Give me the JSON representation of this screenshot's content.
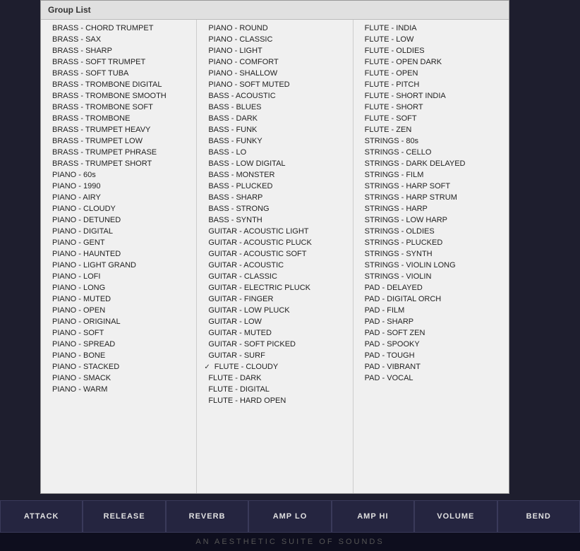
{
  "header": {
    "title": "Group List"
  },
  "footer": {
    "text": "AN AESTHETIC SUITE OF SOUNDS"
  },
  "controls": [
    {
      "id": "attack",
      "label": "ATTACK"
    },
    {
      "id": "release",
      "label": "RELEASE"
    },
    {
      "id": "reverb",
      "label": "REVERB"
    },
    {
      "id": "amp-lo",
      "label": "AMP LO"
    },
    {
      "id": "amp-hi",
      "label": "AMP HI"
    },
    {
      "id": "volume",
      "label": "VOLUME"
    },
    {
      "id": "bend",
      "label": "BEND"
    }
  ],
  "columns": [
    {
      "id": "col1",
      "items": [
        {
          "label": "BRASS - CHORD TRUMPET",
          "checked": false
        },
        {
          "label": "BRASS - SAX",
          "checked": false
        },
        {
          "label": "BRASS - SHARP",
          "checked": false
        },
        {
          "label": "BRASS - SOFT TRUMPET",
          "checked": false
        },
        {
          "label": "BRASS - SOFT TUBA",
          "checked": false
        },
        {
          "label": "BRASS - TROMBONE DIGITAL",
          "checked": false
        },
        {
          "label": "BRASS - TROMBONE SMOOTH",
          "checked": false
        },
        {
          "label": "BRASS - TROMBONE SOFT",
          "checked": false
        },
        {
          "label": "BRASS - TROMBONE",
          "checked": false
        },
        {
          "label": "BRASS - TRUMPET HEAVY",
          "checked": false
        },
        {
          "label": "BRASS - TRUMPET LOW",
          "checked": false
        },
        {
          "label": "BRASS - TRUMPET PHRASE",
          "checked": false
        },
        {
          "label": "BRASS - TRUMPET SHORT",
          "checked": false
        },
        {
          "label": "PIANO - 60s",
          "checked": false
        },
        {
          "label": "PIANO - 1990",
          "checked": false
        },
        {
          "label": "PIANO - AIRY",
          "checked": false
        },
        {
          "label": "PIANO - CLOUDY",
          "checked": false
        },
        {
          "label": "PIANO - DETUNED",
          "checked": false
        },
        {
          "label": "PIANO - DIGITAL",
          "checked": false
        },
        {
          "label": "PIANO - GENT",
          "checked": false
        },
        {
          "label": "PIANO - HAUNTED",
          "checked": false
        },
        {
          "label": "PIANO - LIGHT GRAND",
          "checked": false
        },
        {
          "label": "PIANO - LOFI",
          "checked": false
        },
        {
          "label": "PIANO - LONG",
          "checked": false
        },
        {
          "label": "PIANO - MUTED",
          "checked": false
        },
        {
          "label": "PIANO - OPEN",
          "checked": false
        },
        {
          "label": "PIANO - ORIGINAL",
          "checked": false
        },
        {
          "label": "PIANO - SOFT",
          "checked": false
        },
        {
          "label": "PIANO - SPREAD",
          "checked": false
        },
        {
          "label": "PIANO - BONE",
          "checked": false
        },
        {
          "label": "PIANO - STACKED",
          "checked": false
        },
        {
          "label": "PIANO - SMACK",
          "checked": false
        },
        {
          "label": "PIANO - WARM",
          "checked": false
        }
      ]
    },
    {
      "id": "col2",
      "items": [
        {
          "label": "PIANO - ROUND",
          "checked": false
        },
        {
          "label": "PIANO - CLASSIC",
          "checked": false
        },
        {
          "label": "PIANO - LIGHT",
          "checked": false
        },
        {
          "label": "PIANO - COMFORT",
          "checked": false
        },
        {
          "label": "PIANO - SHALLOW",
          "checked": false
        },
        {
          "label": "PIANO - SOFT MUTED",
          "checked": false
        },
        {
          "label": "BASS - ACOUSTIC",
          "checked": false
        },
        {
          "label": "BASS - BLUES",
          "checked": false
        },
        {
          "label": "BASS - DARK",
          "checked": false
        },
        {
          "label": "BASS - FUNK",
          "checked": false
        },
        {
          "label": "BASS - FUNKY",
          "checked": false
        },
        {
          "label": "BASS - LO",
          "checked": false
        },
        {
          "label": "BASS - LOW DIGITAL",
          "checked": false
        },
        {
          "label": "BASS - MONSTER",
          "checked": false
        },
        {
          "label": "BASS - PLUCKED",
          "checked": false
        },
        {
          "label": "BASS - SHARP",
          "checked": false
        },
        {
          "label": "BASS - STRONG",
          "checked": false
        },
        {
          "label": "BASS - SYNTH",
          "checked": false
        },
        {
          "label": "GUITAR - ACOUSTIC LIGHT",
          "checked": false
        },
        {
          "label": "GUITAR - ACOUSTIC PLUCK",
          "checked": false
        },
        {
          "label": "GUITAR - ACOUSTIC SOFT",
          "checked": false
        },
        {
          "label": "GUITAR - ACOUSTIC",
          "checked": false
        },
        {
          "label": "GUITAR - CLASSIC",
          "checked": false
        },
        {
          "label": "GUITAR - ELECTRIC PLUCK",
          "checked": false
        },
        {
          "label": "GUITAR - FINGER",
          "checked": false
        },
        {
          "label": "GUITAR - LOW PLUCK",
          "checked": false
        },
        {
          "label": "GUITAR - LOW",
          "checked": false
        },
        {
          "label": "GUITAR - MUTED",
          "checked": false
        },
        {
          "label": "GUITAR - SOFT PICKED",
          "checked": false
        },
        {
          "label": "GUITAR - SURF",
          "checked": false
        },
        {
          "label": "FLUTE - CLOUDY",
          "checked": true
        },
        {
          "label": "FLUTE - DARK",
          "checked": false
        },
        {
          "label": "FLUTE - DIGITAL",
          "checked": false
        },
        {
          "label": "FLUTE - HARD OPEN",
          "checked": false
        }
      ]
    },
    {
      "id": "col3",
      "items": [
        {
          "label": "FLUTE - INDIA",
          "checked": false
        },
        {
          "label": "FLUTE - LOW",
          "checked": false
        },
        {
          "label": "FLUTE - OLDIES",
          "checked": false
        },
        {
          "label": "FLUTE - OPEN DARK",
          "checked": false
        },
        {
          "label": "FLUTE - OPEN",
          "checked": false
        },
        {
          "label": "FLUTE - PITCH",
          "checked": false
        },
        {
          "label": "FLUTE - SHORT INDIA",
          "checked": false
        },
        {
          "label": "FLUTE - SHORT",
          "checked": false
        },
        {
          "label": "FLUTE - SOFT",
          "checked": false
        },
        {
          "label": "FLUTE - ZEN",
          "checked": false
        },
        {
          "label": "STRINGS - 80s",
          "checked": false
        },
        {
          "label": "STRINGS - CELLO",
          "checked": false
        },
        {
          "label": "STRINGS - DARK DELAYED",
          "checked": false
        },
        {
          "label": "STRINGS - FILM",
          "checked": false
        },
        {
          "label": "STRINGS - HARP SOFT",
          "checked": false
        },
        {
          "label": "STRINGS - HARP STRUM",
          "checked": false
        },
        {
          "label": "STRINGS - HARP",
          "checked": false
        },
        {
          "label": "STRINGS - LOW HARP",
          "checked": false
        },
        {
          "label": "STRINGS - OLDIES",
          "checked": false
        },
        {
          "label": "STRINGS - PLUCKED",
          "checked": false
        },
        {
          "label": "STRINGS - SYNTH",
          "checked": false
        },
        {
          "label": "STRINGS - VIOLIN LONG",
          "checked": false
        },
        {
          "label": "STRINGS - VIOLIN",
          "checked": false
        },
        {
          "label": "PAD - DELAYED",
          "checked": false
        },
        {
          "label": "PAD - DIGITAL ORCH",
          "checked": false
        },
        {
          "label": "PAD - FILM",
          "checked": false
        },
        {
          "label": "PAD - SHARP",
          "checked": false
        },
        {
          "label": "PAD - SOFT ZEN",
          "checked": false
        },
        {
          "label": "PAD - SPOOKY",
          "checked": false
        },
        {
          "label": "PAD - TOUGH",
          "checked": false
        },
        {
          "label": "PAD - VIBRANT",
          "checked": false
        },
        {
          "label": "PAD - VOCAL",
          "checked": false
        }
      ]
    }
  ]
}
